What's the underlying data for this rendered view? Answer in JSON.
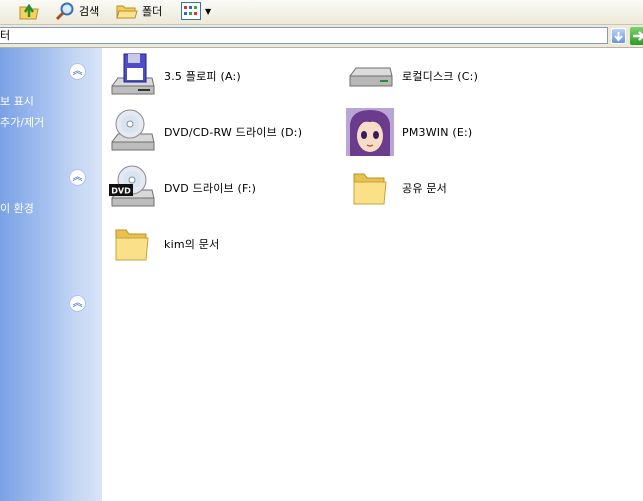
{
  "toolbar": {
    "search_label": "검색",
    "folders_label": "폴더"
  },
  "address": {
    "value": "터"
  },
  "task_pane": {
    "links": [
      "보 표시",
      "추가/제거",
      "이 환경"
    ]
  },
  "items": [
    {
      "label": "3.5 플로피 (A:)",
      "icon": "floppy-drive-icon"
    },
    {
      "label": "로컬디스크 (C:)",
      "icon": "hard-drive-icon"
    },
    {
      "label": "DVD/CD-RW 드라이브 (D:)",
      "icon": "cd-drive-icon"
    },
    {
      "label": "PM3WIN (E:)",
      "icon": "anime-avatar-drive-icon"
    },
    {
      "label": "DVD 드라이브 (F:)",
      "icon": "dvd-drive-icon",
      "badge": "DVD"
    },
    {
      "label": "공유 문서",
      "icon": "folder-icon"
    },
    {
      "label": "kim의 문서",
      "icon": "folder-icon"
    }
  ]
}
